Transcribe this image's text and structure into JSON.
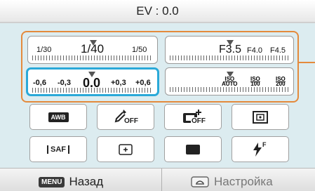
{
  "header": {
    "title": "EV : 0.0"
  },
  "shutter": {
    "left": "1/30",
    "center": "1/40",
    "right": "1/50"
  },
  "aperture": {
    "center": "F3.5",
    "mid": "F4.0",
    "right": "F4.5"
  },
  "ev": {
    "v1": "-0,6",
    "v2": "-0,3",
    "center": "0.0",
    "v3": "+0,3",
    "v4": "+0,6"
  },
  "iso": {
    "items": [
      {
        "label": "ISO",
        "value": "AUTO"
      },
      {
        "label": "ISO",
        "value": "100"
      },
      {
        "label": "ISO",
        "value": "200"
      }
    ]
  },
  "buttons": {
    "awb": "AWB",
    "effect_off": "OFF",
    "flash_off": "OFF",
    "saf": "SAF",
    "flash_superscript": "F"
  },
  "footer": {
    "menu_key": "MENU",
    "back_label": "Назад",
    "settings_label": "Настройка"
  },
  "colors": {
    "accent": "#e48a3c",
    "selection": "#2aa9d8"
  }
}
